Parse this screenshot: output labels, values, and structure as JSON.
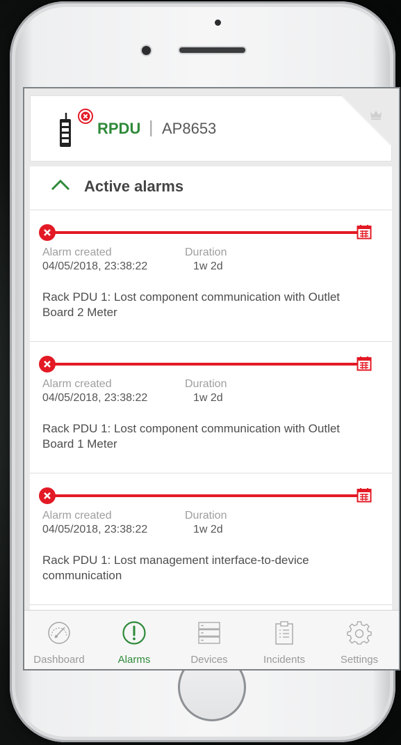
{
  "header": {
    "device_type": "RPDU",
    "separator": "|",
    "model": "AP8653"
  },
  "section": {
    "title": "Active alarms"
  },
  "alarms": [
    {
      "created_label": "Alarm created",
      "duration_label": "Duration",
      "created": "04/05/2018, 23:38:22",
      "duration": "1w 2d",
      "message": "Rack PDU 1: Lost component communication with Outlet Board 2 Meter"
    },
    {
      "created_label": "Alarm created",
      "duration_label": "Duration",
      "created": "04/05/2018, 23:38:22",
      "duration": "1w 2d",
      "message": "Rack PDU 1: Lost component communication with Outlet Board 1 Meter"
    },
    {
      "created_label": "Alarm created",
      "duration_label": "Duration",
      "created": "04/05/2018, 23:38:22",
      "duration": "1w 2d",
      "message": "Rack PDU 1: Lost management interface-to-device communication"
    }
  ],
  "tabs": [
    {
      "label": "Dashboard",
      "icon": "gauge-icon",
      "active": false
    },
    {
      "label": "Alarms",
      "icon": "alert-circle-icon",
      "active": true
    },
    {
      "label": "Devices",
      "icon": "server-rack-icon",
      "active": false
    },
    {
      "label": "Incidents",
      "icon": "clipboard-icon",
      "active": false
    },
    {
      "label": "Settings",
      "icon": "gear-icon",
      "active": false
    }
  ],
  "colors": {
    "accent": "#2f8a3a",
    "alarm": "#e31a25",
    "inactive": "#9a9a9a"
  }
}
